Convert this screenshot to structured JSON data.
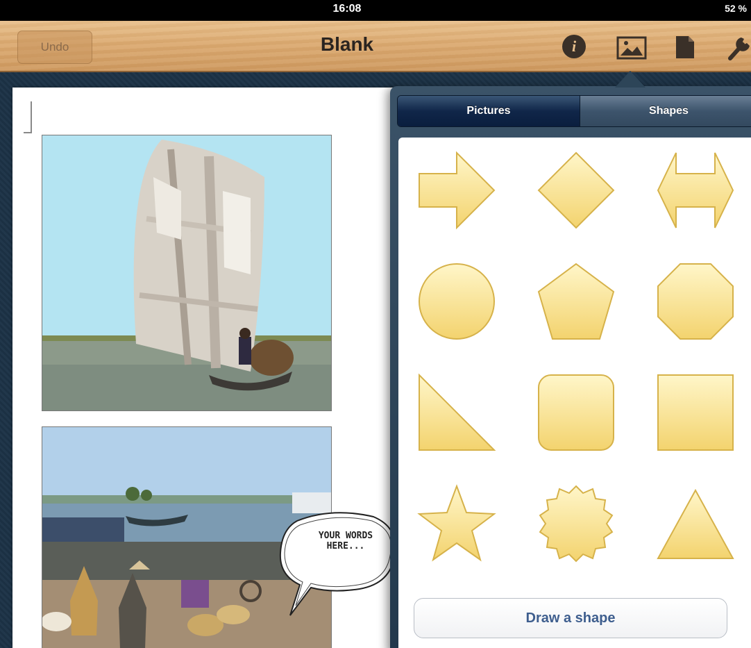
{
  "status_bar": {
    "time": "16:08",
    "battery": "52 %"
  },
  "toolbar": {
    "undo_label": "Undo",
    "title": "Blank",
    "icons": [
      "info-icon",
      "image-icon",
      "page-icon",
      "wrench-icon"
    ]
  },
  "document": {
    "images": [
      "sailboat-photo",
      "river-market-photo"
    ],
    "speech_bubble_text": "YOUR WORDS HERE..."
  },
  "popover": {
    "tabs": [
      {
        "label": "Pictures",
        "selected": true
      },
      {
        "label": "Shapes",
        "selected": false
      }
    ],
    "shapes": [
      "arrow-right",
      "diamond",
      "double-arrow",
      "circle",
      "pentagon",
      "octagon",
      "right-triangle",
      "rounded-square",
      "square",
      "star",
      "starburst",
      "triangle"
    ],
    "draw_shape_label": "Draw a shape"
  },
  "colors": {
    "shape_fill_top": "#fff6c9",
    "shape_fill_bottom": "#f3d36e",
    "shape_stroke": "#d6b24a",
    "toolbar_wood": "#dcab72",
    "popover_tab_selected": "#0a1e3e"
  }
}
